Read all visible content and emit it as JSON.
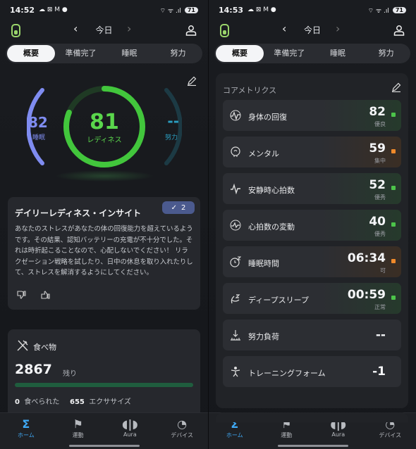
{
  "left": {
    "status": {
      "time": "14:52",
      "icons": "☁ ⊠ M ●",
      "right": "⌔ ᯤ .ıl",
      "battery": "71"
    },
    "date": "今日",
    "tabs": [
      "概要",
      "準備完了",
      "睡眠",
      "努力"
    ],
    "readiness": {
      "score": "81",
      "label": "レディネス",
      "sleep_score": "82",
      "sleep_label": "睡眠",
      "effort_score": "--",
      "effort_label": "努力",
      "score_value": 81,
      "sleep_value": 82
    },
    "insight": {
      "title": "デイリーレディネス・インサイト",
      "badge_count": "2",
      "body": "あなたのストレスがあなたの体の回復能力を超えているようです。その結果、認知バッテリーの充電が不十分でした。それは時折起こることなので、心配しないでください！ リラクゼーション戦略を試したり、日中の休息を取り入れたりして、ストレスを解消するようにしてください。"
    },
    "food": {
      "title": "食べ物",
      "remaining": "2867",
      "remaining_label": "残り",
      "eaten_value": "0",
      "eaten_label": "食べられた",
      "exercise_value": "655",
      "exercise_label": "エクササイズ"
    }
  },
  "right": {
    "status": {
      "time": "14:53",
      "icons": "☁ ⊠ M ●",
      "right": "⌔ ᯤ .ıl",
      "battery": "71"
    },
    "date": "今日",
    "tabs": [
      "概要",
      "準備完了",
      "睡眠",
      "努力"
    ],
    "metrics_title": "コアメトリクス",
    "metrics": [
      {
        "label": "身体の回復",
        "value": "82",
        "status": "優良",
        "dot": "#4cc44a",
        "icon": "pulse-icon"
      },
      {
        "label": "メンタル",
        "value": "59",
        "status": "集中",
        "dot": "#f08a2a",
        "icon": "brain-icon"
      },
      {
        "label": "安静時心拍数",
        "value": "52",
        "status": "優秀",
        "dot": "#4cc44a",
        "icon": "heartbeat-icon"
      },
      {
        "label": "心拍数の変動",
        "value": "40",
        "status": "優秀",
        "dot": "#4cc44a",
        "icon": "hrv-icon"
      },
      {
        "label": "睡眠時間",
        "value": "06:34",
        "status": "可",
        "dot": "#f08a2a",
        "icon": "sleep-time-icon"
      },
      {
        "label": "ディープスリープ",
        "value": "00:59",
        "status": "正常",
        "dot": "#4cc44a",
        "icon": "deep-sleep-icon"
      },
      {
        "label": "努力負荷",
        "value": "--",
        "status": "",
        "dot": "",
        "icon": "effort-load-icon"
      },
      {
        "label": "トレーニングフォーム",
        "value": "-1",
        "status": "",
        "dot": "",
        "icon": "training-form-icon"
      }
    ]
  },
  "nav": [
    {
      "label": "ホーム",
      "glyph": "Σ",
      "icon": "home-sigma-icon"
    },
    {
      "label": "運動",
      "glyph": "⚑",
      "icon": "exercise-icon"
    },
    {
      "label": "Aura",
      "glyph": "◖|◗",
      "icon": "aura-icon"
    },
    {
      "label": "デバイス",
      "glyph": "◔",
      "icon": "device-icon"
    }
  ],
  "colors": {
    "accent": "#3fa9f5",
    "readiness": "#5ad64c",
    "sleep": "#7f8cf0",
    "effort": "#2a9ec0",
    "good": "#4cc44a",
    "fair": "#f08a2a"
  }
}
